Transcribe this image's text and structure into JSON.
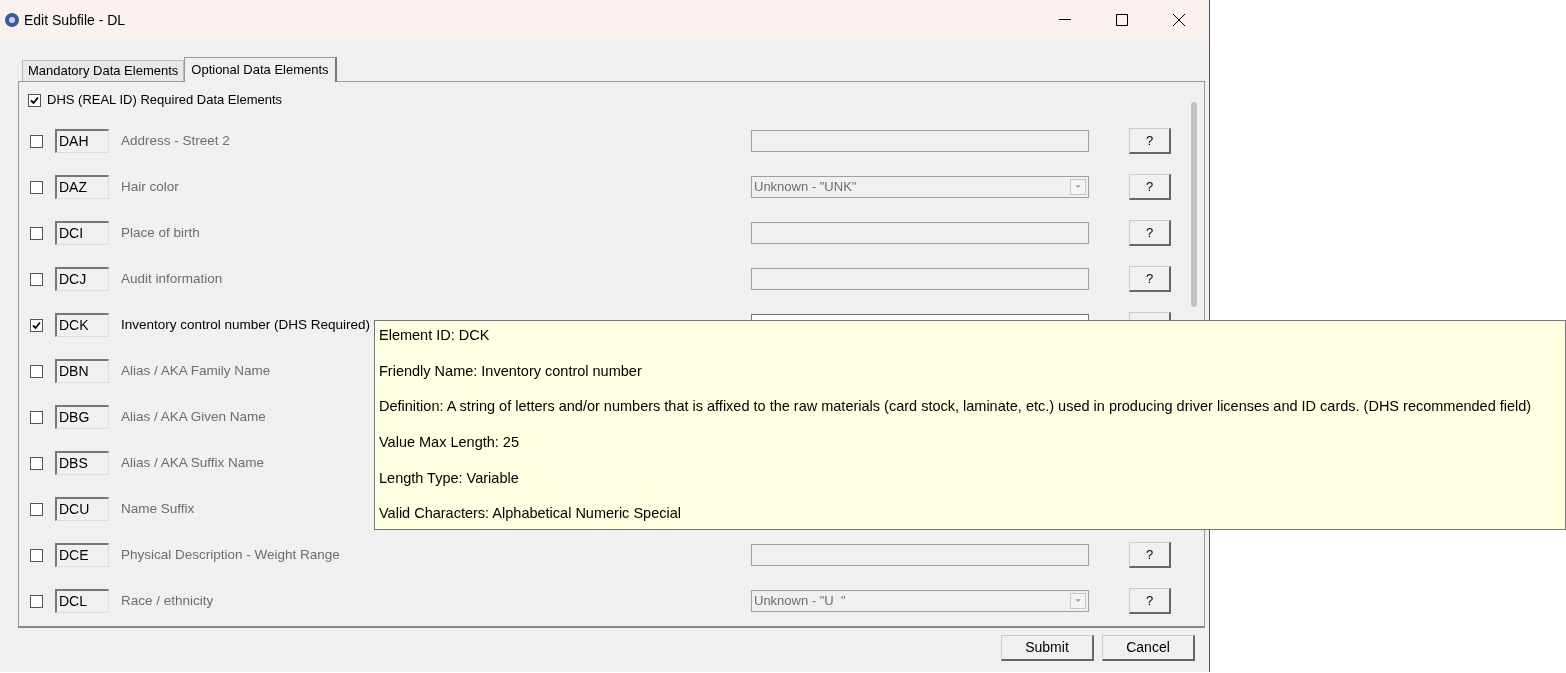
{
  "window": {
    "title": "Edit Subfile - DL"
  },
  "tabs": [
    {
      "label": "Mandatory Data Elements",
      "selected": false
    },
    {
      "label": "Optional Data Elements",
      "selected": true
    }
  ],
  "dhs_required": {
    "label": "DHS (REAL ID) Required Data Elements",
    "checked": true
  },
  "rows": [
    {
      "checked": false,
      "code": "DAH",
      "label": "Address - Street 2",
      "field": {
        "kind": "text"
      },
      "help_button": "?"
    },
    {
      "checked": false,
      "code": "DAZ",
      "label": "Hair color",
      "field": {
        "kind": "dropdown",
        "value": "Unknown - \"UNK\""
      },
      "help_button": "?"
    },
    {
      "checked": false,
      "code": "DCI",
      "label": "Place of birth",
      "field": {
        "kind": "text"
      },
      "help_button": "?"
    },
    {
      "checked": false,
      "code": "DCJ",
      "label": "Audit information",
      "field": {
        "kind": "text"
      },
      "help_button": "?"
    },
    {
      "checked": true,
      "code": "DCK",
      "label": "Inventory control number (DHS Required)",
      "field": {
        "kind": "text"
      }
    },
    {
      "checked": false,
      "code": "DBN",
      "label": "Alias / AKA Family Name"
    },
    {
      "checked": false,
      "code": "DBG",
      "label": "Alias / AKA Given Name"
    },
    {
      "checked": false,
      "code": "DBS",
      "label": "Alias / AKA Suffix Name"
    },
    {
      "checked": false,
      "code": "DCU",
      "label": "Name Suffix"
    },
    {
      "checked": false,
      "code": "DCE",
      "label": "Physical Description - Weight Range",
      "field": {
        "kind": "text"
      },
      "help_button": "?"
    },
    {
      "checked": false,
      "code": "DCL",
      "label": "Race / ethnicity",
      "field": {
        "kind": "dropdown",
        "value": "Unknown - \"U  \""
      },
      "help_button": "?"
    }
  ],
  "tooltip": {
    "lines": [
      "Element ID: DCK",
      "Friendly Name: Inventory control number",
      "Definition: A string of letters and/or numbers that is affixed to the raw materials (card stock, laminate, etc.) used in producing driver licenses and ID cards. (DHS recommended field)",
      "Value Max Length: 25",
      "Length Type: Variable",
      "Valid Characters: Alphabetical Numeric Special"
    ]
  },
  "buttons": [
    "Submit",
    "Cancel"
  ]
}
